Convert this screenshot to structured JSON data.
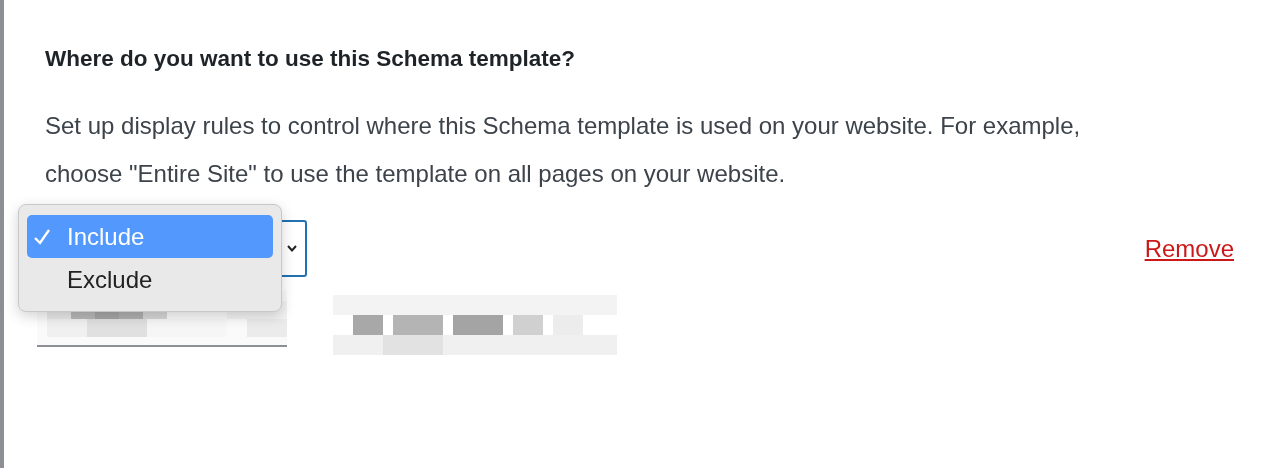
{
  "heading": "Where do you want to use this Schema template?",
  "description": "Set up display rules to control where this Schema template is used on your website. For example, choose \"Entire Site\" to use the template on all pages on your website.",
  "rule": {
    "dropdown_open": true,
    "options": [
      {
        "label": "Include",
        "selected": true
      },
      {
        "label": "Exclude",
        "selected": false
      }
    ],
    "remove_label": "Remove"
  }
}
